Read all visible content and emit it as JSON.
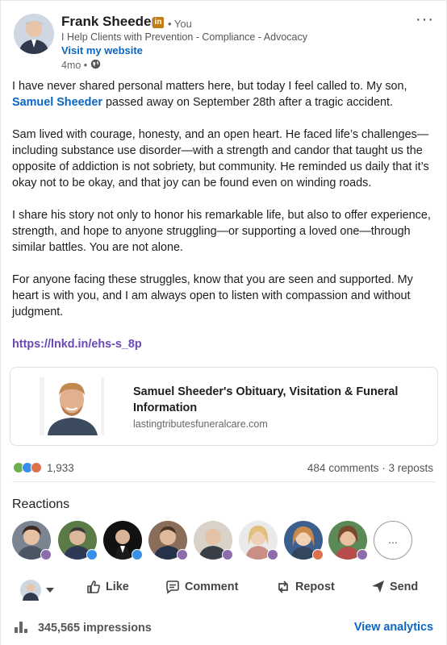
{
  "author": {
    "name": "Frank Sheeder",
    "badge": "in",
    "you_label": "• You",
    "headline": "I Help Clients with Prevention - Compliance - Advocacy",
    "visit_link": "Visit my website",
    "age": "4mo •"
  },
  "post": {
    "p1_a": "I have never shared personal matters here, but today I feel called to. My son, ",
    "p1_mention": "Samuel Sheeder",
    "p1_b": " passed away on September 28th after a tragic accident.",
    "p2": "Sam lived with courage, honesty, and an open heart. He faced life’s challenges—including substance use disorder—with a strength and candor that taught us the opposite of addiction is not sobriety, but community. He reminded us daily that it’s okay not to be okay, and that joy can be found even on winding roads.",
    "p3": "I share his story not only to honor his remarkable life, but also to offer experience, strength, and hope to anyone struggling—or supporting a loved one—through similar battles. You are not alone.",
    "p4": "For anyone facing these struggles, know that you are seen and supported. My heart is with you, and I am always open to listen with compassion and without judgment.",
    "link": "https://lnkd.in/ehs-s_8p"
  },
  "preview": {
    "title": "Samuel Sheeder's Obituary, Visitation & Funeral Information",
    "domain": "lastingtributesfuneralcare.com"
  },
  "social": {
    "reaction_count": "1,933",
    "comments_reposts": "484 comments · 3 reposts",
    "reactions_heading": "Reactions",
    "more_label": "..."
  },
  "actions": {
    "like": "Like",
    "comment": "Comment",
    "repost": "Repost",
    "send": "Send"
  },
  "footer": {
    "impressions": "345,565 impressions",
    "view_analytics": "View analytics"
  },
  "colors": {
    "accent": "#0a66c2",
    "link_purple": "#6a48b5",
    "badge": "#c37d16"
  }
}
